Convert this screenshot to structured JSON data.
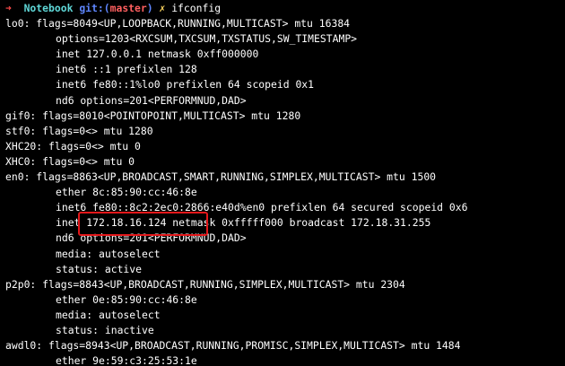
{
  "prompt": {
    "arrow": "➜",
    "directory": "Notebook",
    "git_prefix": "git:(",
    "branch": "master",
    "git_suffix": ")",
    "dirty_mark": "✗",
    "command": "ifconfig"
  },
  "output_lines": [
    {
      "indent": 0,
      "text": "lo0: flags=8049<UP,LOOPBACK,RUNNING,MULTICAST> mtu 16384"
    },
    {
      "indent": 1,
      "text": "options=1203<RXCSUM,TXCSUM,TXSTATUS,SW_TIMESTAMP>"
    },
    {
      "indent": 1,
      "text": "inet 127.0.0.1 netmask 0xff000000"
    },
    {
      "indent": 1,
      "text": "inet6 ::1 prefixlen 128"
    },
    {
      "indent": 1,
      "text": "inet6 fe80::1%lo0 prefixlen 64 scopeid 0x1"
    },
    {
      "indent": 1,
      "text": "nd6 options=201<PERFORMNUD,DAD>"
    },
    {
      "indent": 0,
      "text": "gif0: flags=8010<POINTOPOINT,MULTICAST> mtu 1280"
    },
    {
      "indent": 0,
      "text": "stf0: flags=0<> mtu 1280"
    },
    {
      "indent": 0,
      "text": "XHC20: flags=0<> mtu 0"
    },
    {
      "indent": 0,
      "text": "XHC0: flags=0<> mtu 0"
    },
    {
      "indent": 0,
      "text": "en0: flags=8863<UP,BROADCAST,SMART,RUNNING,SIMPLEX,MULTICAST> mtu 1500"
    },
    {
      "indent": 1,
      "text": "ether 8c:85:90:cc:46:8e"
    },
    {
      "indent": 1,
      "text": "inet6 fe80::8c2:2ec0:2866:e40d%en0 prefixlen 64 secured scopeid 0x6"
    },
    {
      "indent": 1,
      "text": "inet 172.18.16.124 netmask 0xfffff000 broadcast 172.18.31.255"
    },
    {
      "indent": 1,
      "text": "nd6 options=201<PERFORMNUD,DAD>"
    },
    {
      "indent": 1,
      "text": "media: autoselect"
    },
    {
      "indent": 1,
      "text": "status: active"
    },
    {
      "indent": 0,
      "text": "p2p0: flags=8843<UP,BROADCAST,RUNNING,SIMPLEX,MULTICAST> mtu 2304"
    },
    {
      "indent": 1,
      "text": "ether 0e:85:90:cc:46:8e"
    },
    {
      "indent": 1,
      "text": "media: autoselect"
    },
    {
      "indent": 1,
      "text": "status: inactive"
    },
    {
      "indent": 0,
      "text": "awdl0: flags=8943<UP,BROADCAST,RUNNING,PROMISC,SIMPLEX,MULTICAST> mtu 1484"
    },
    {
      "indent": 1,
      "text": "ether 9e:59:c3:25:53:1e"
    }
  ],
  "colors": {
    "background": "#000000",
    "text": "#ffffff",
    "arrow": "#ff4b4b",
    "directory": "#5fd7d7",
    "git": "#5f87ff",
    "branch": "#ff5f5f",
    "dirty": "#ffd75f",
    "highlight_border": "#e3171a"
  }
}
